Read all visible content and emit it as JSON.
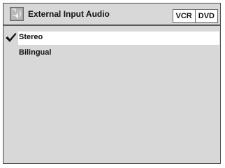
{
  "header": {
    "title": "External Input Audio",
    "icon": "audio-input-icon",
    "modes": [
      {
        "label": "VCR"
      },
      {
        "label": "DVD"
      }
    ]
  },
  "menu": {
    "items": [
      {
        "label": "Stereo",
        "selected": true
      },
      {
        "label": "Bilingual",
        "selected": false
      }
    ]
  },
  "colors": {
    "background": "#d8d8d8",
    "border": "#4a4a4a",
    "highlight": "#ffffff",
    "text": "#111111"
  }
}
